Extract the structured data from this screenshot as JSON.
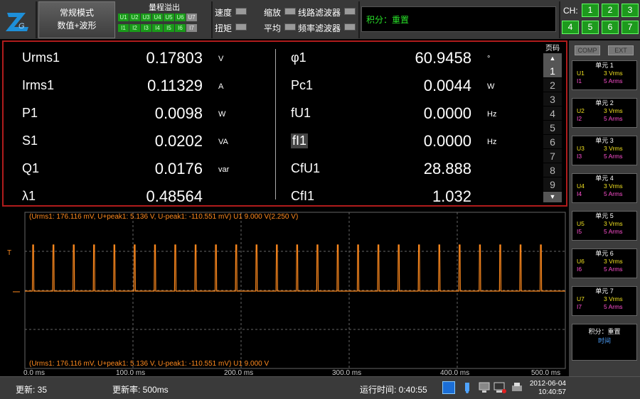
{
  "topbar": {
    "mode_line1": "常规模式",
    "mode_line2": "数值+波形",
    "range_title": "量程溢出",
    "u_ranges": [
      "U1",
      "U2",
      "U3",
      "U4",
      "U5",
      "U6",
      "U7"
    ],
    "i_ranges": [
      "I1",
      "I2",
      "I3",
      "I4",
      "I5",
      "I6",
      "I7"
    ],
    "options": [
      "速度",
      "扭矩",
      "缩放",
      "平均",
      "线路滤波器",
      "频率滤波器"
    ],
    "integration_label": "积分：重置",
    "ch_label": "CH:",
    "channels": [
      "1",
      "2",
      "3",
      "4",
      "5",
      "6",
      "7"
    ],
    "colors": {
      "accent_green": "#1d9a1d",
      "alarm_red": "#b01c1c",
      "wave_orange": "#ff8a1e"
    }
  },
  "measure": {
    "rows": [
      {
        "lname": "Urms1",
        "lval": "0.17803",
        "lunit": "V",
        "rname": "φ1",
        "rval": "60.9458",
        "runit": "°"
      },
      {
        "lname": "Irms1",
        "lval": "0.11329",
        "lunit": "A",
        "rname": "Pc1",
        "rval": "0.0044",
        "runit": "W"
      },
      {
        "lname": "P1",
        "lval": "0.0098",
        "lunit": "W",
        "rname": "fU1",
        "rval": "0.0000",
        "runit": "Hz"
      },
      {
        "lname": "S1",
        "lval": "0.0202",
        "lunit": "VA",
        "rname": "fI1",
        "rval": "0.0000",
        "runit": "Hz"
      },
      {
        "lname": "Q1",
        "lval": "0.0176",
        "lunit": "var",
        "rname": "CfU1",
        "rval": "28.888",
        "runit": ""
      },
      {
        "lname": "λ1",
        "lval": "0.48564",
        "lunit": "",
        "rname": "CfI1",
        "rval": "1.032",
        "runit": ""
      }
    ],
    "page_label": "页码",
    "pages": [
      "1",
      "2",
      "3",
      "4",
      "5",
      "6",
      "7",
      "8",
      "9"
    ],
    "active_page": "1"
  },
  "wave": {
    "top_info": "(Urms1: 176.116 mV, U+peak1: 5.136 V, U-peak1: -110.551 mV) U1   9.000 V(2.250 V)",
    "bottom_info": "(Urms1: 176.116 mV, U+peak1: 5.136 V, U-peak1: -110.551 mV) U1   9.000 V",
    "trigger_mark": "T",
    "x_ticks": [
      "0.0 ms",
      "100.0 ms",
      "200.0 ms",
      "300.0 ms",
      "400.0 ms",
      "500.0 ms"
    ],
    "pulse_count": 26
  },
  "right": {
    "comp": "COMP",
    "ext": "EXT",
    "elements": [
      {
        "title": "单元 1",
        "u": "U1",
        "uv": "3 Vrms",
        "i": "I1",
        "iv": "5 Arms"
      },
      {
        "title": "单元 2",
        "u": "U2",
        "uv": "3 Vrms",
        "i": "I2",
        "iv": "5 Arms"
      },
      {
        "title": "单元 3",
        "u": "U3",
        "uv": "3 Vrms",
        "i": "I3",
        "iv": "5 Arms"
      },
      {
        "title": "单元 4",
        "u": "U4",
        "uv": "3 Vrms",
        "i": "I4",
        "iv": "5 Arms"
      },
      {
        "title": "单元 5",
        "u": "U5",
        "uv": "3 Vrms",
        "i": "I5",
        "iv": "5 Arms"
      },
      {
        "title": "单元 6",
        "u": "U6",
        "uv": "3 Vrms",
        "i": "I6",
        "iv": "5 Arms"
      },
      {
        "title": "单元 7",
        "u": "U7",
        "uv": "3 Vrms",
        "i": "I7",
        "iv": "5 Arms"
      }
    ],
    "integ_title": "积分：重置",
    "integ_status": "时间"
  },
  "status": {
    "update": "更新: 35",
    "rate": "更新率: 500ms",
    "runtime": "运行时间: 0:40:55",
    "date": "2012-06-04",
    "time": "10:40:57"
  }
}
